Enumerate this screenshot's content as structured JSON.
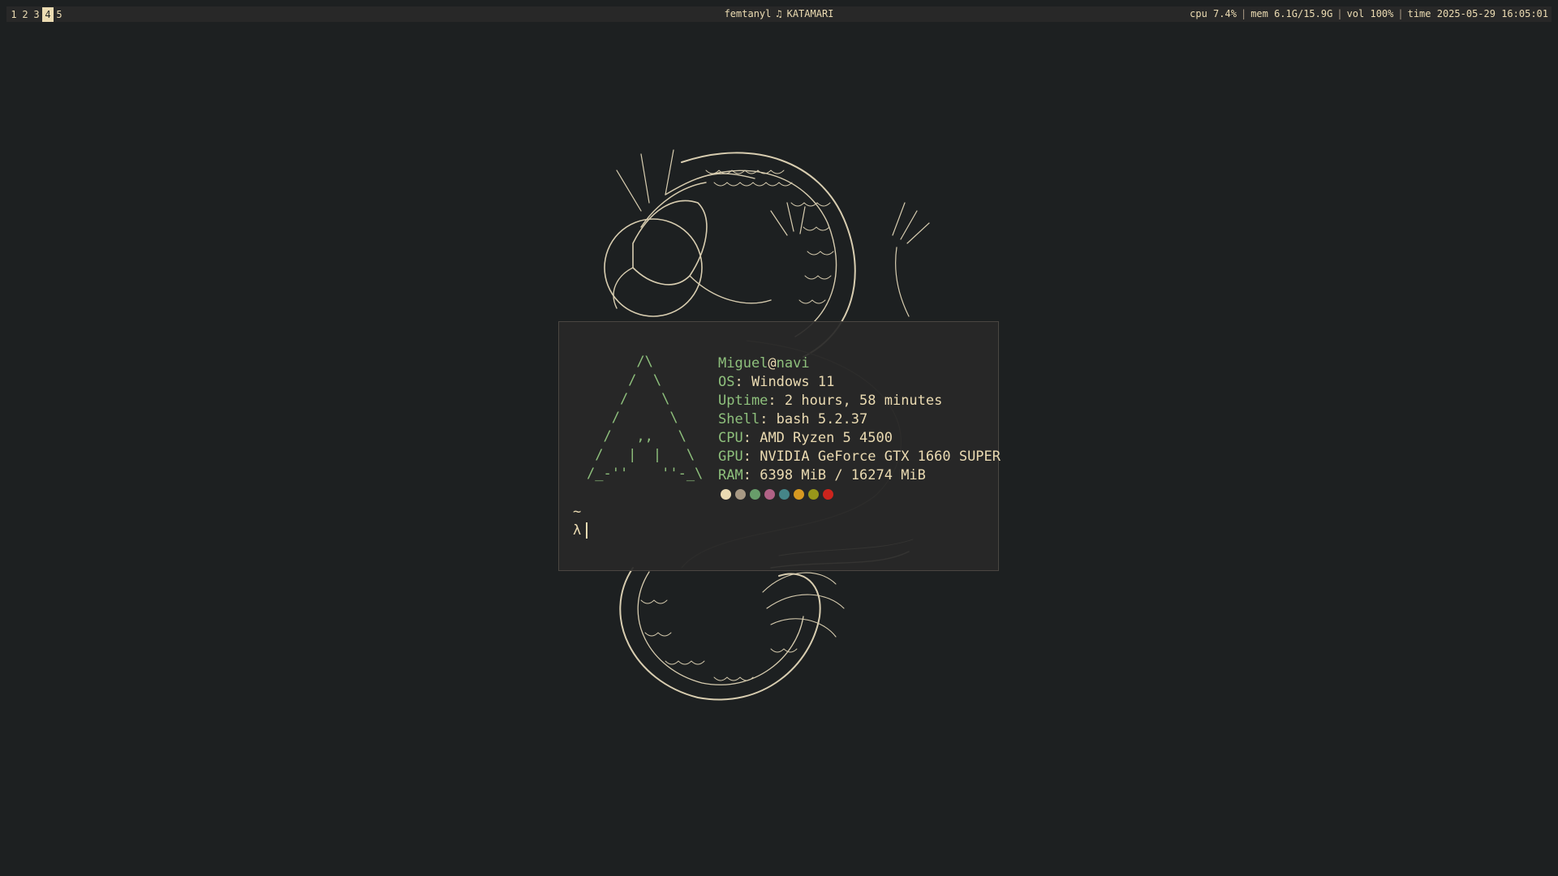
{
  "bar": {
    "workspaces": [
      {
        "label": "1",
        "active": false
      },
      {
        "label": "2",
        "active": false
      },
      {
        "label": "3",
        "active": false
      },
      {
        "label": "4",
        "active": true
      },
      {
        "label": "5",
        "active": false
      }
    ],
    "now_playing": {
      "artist": "femtanyl",
      "icon": "music-note-icon",
      "track": "KATAMARI"
    },
    "status": {
      "cpu": "cpu 7.4%",
      "mem": "mem 6.1G/15.9G",
      "vol": "vol 100%",
      "time": "time 2025-05-29 16:05:01"
    }
  },
  "terminal": {
    "ascii_logo": "      /\\\n     /  \\\n    /    \\\n   /      \\\n  /   ,,   \\\n /   |  |   \\\n/_-''    ''-_\\",
    "user": "Miguel",
    "at": "@",
    "host": "navi",
    "info": [
      {
        "key": "OS",
        "value": "Windows 11"
      },
      {
        "key": "Uptime",
        "value": "2 hours, 58 minutes"
      },
      {
        "key": "Shell",
        "value": "bash 5.2.37"
      },
      {
        "key": "CPU",
        "value": "AMD Ryzen 5 4500"
      },
      {
        "key": "GPU",
        "value": "NVIDIA GeForce GTX 1660 SUPER"
      },
      {
        "key": "RAM",
        "value": "6398 MiB / 16274 MiB"
      }
    ],
    "palette": [
      "#ebdbb2",
      "#a89984",
      "#689d6a",
      "#b16286",
      "#458588",
      "#d79921",
      "#98971a",
      "#cc241d"
    ],
    "cwd": "~",
    "prompt": "λ"
  },
  "colors": {
    "background": "#1d2021",
    "bar_bg": "#282828",
    "foreground": "#ebdbb2",
    "accent_green": "#8ec07c"
  }
}
